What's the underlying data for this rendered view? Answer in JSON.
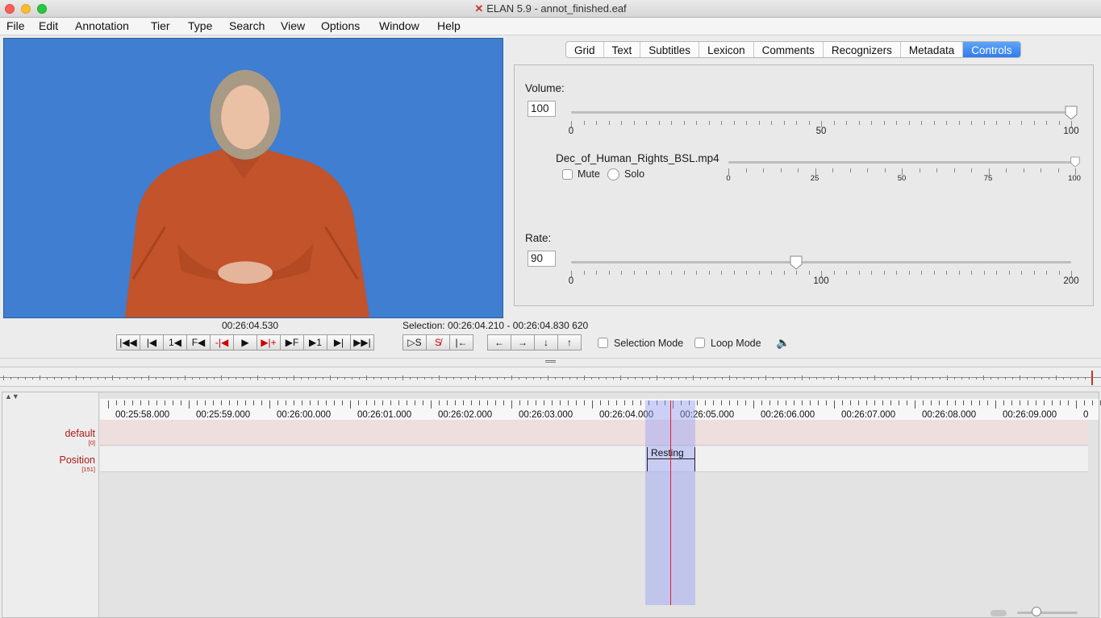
{
  "window": {
    "title": "ELAN 5.9 - annot_finished.eaf",
    "app_icon": "elan-app-icon"
  },
  "menu": [
    "File",
    "Edit",
    "Annotation",
    "Tier",
    "Type",
    "Search",
    "View",
    "Options",
    "Window",
    "Help"
  ],
  "tabs": [
    {
      "label": "Grid",
      "active": false
    },
    {
      "label": "Text",
      "active": false
    },
    {
      "label": "Subtitles",
      "active": false
    },
    {
      "label": "Lexicon",
      "active": false
    },
    {
      "label": "Comments",
      "active": false
    },
    {
      "label": "Recognizers",
      "active": false
    },
    {
      "label": "Metadata",
      "active": false
    },
    {
      "label": "Controls",
      "active": true
    }
  ],
  "controls": {
    "volume": {
      "label": "Volume:",
      "value": "100",
      "min_label": "0",
      "mid_label": "50",
      "max_label": "100",
      "level": 100
    },
    "media": {
      "file_name": "Dec_of_Human_Rights_BSL.mp4",
      "mute_label": "Mute",
      "solo_label": "Solo",
      "mute_checked": false,
      "solo_selected": false,
      "tick_labels": [
        "0",
        "25",
        "50",
        "75",
        "100"
      ],
      "level": 100
    },
    "rate": {
      "label": "Rate:",
      "value": "90",
      "min_label": "0",
      "mid_label": "100",
      "max_label": "200",
      "level": 90,
      "max": 200
    }
  },
  "player": {
    "current_time": "00:26:04.530",
    "selection": "Selection: 00:26:04.210 - 00:26:04.830  620",
    "selection_mode_label": "Selection Mode",
    "loop_mode_label": "Loop Mode",
    "selection_mode_checked": false,
    "loop_mode_checked": false
  },
  "timeline": {
    "ruler_labels": [
      "00:25:58.000",
      "00:25:59.000",
      "00:26:00.000",
      "00:26:01.000",
      "00:26:02.000",
      "00:26:03.000",
      "00:26:04.000",
      "00:26:05.000",
      "00:26:06.000",
      "00:26:07.000",
      "00:26:08.000",
      "00:26:09.000",
      "0"
    ],
    "tiers": [
      {
        "name": "default",
        "count": "[0]"
      },
      {
        "name": "Position",
        "count": "[151]"
      }
    ],
    "annotation": {
      "label": "Resting",
      "tier": "Position"
    }
  },
  "colors": {
    "accent": "#2d79ec",
    "tier_name": "#b01a1a",
    "crosshair": "#e0202b",
    "selection": "#9aa0f5",
    "video_bg": "#3f7ed0"
  }
}
